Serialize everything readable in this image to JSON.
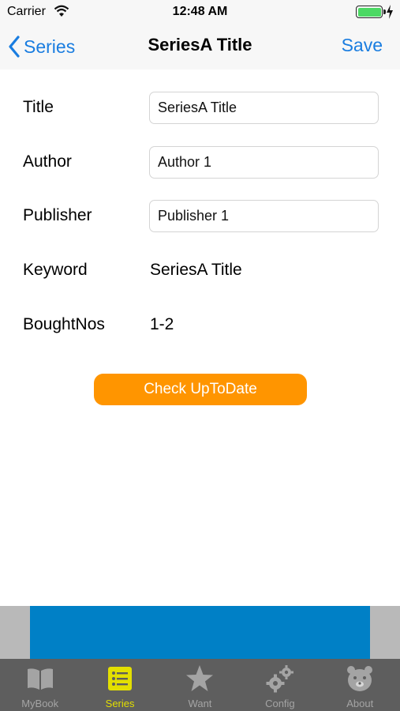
{
  "status_bar": {
    "carrier": "Carrier",
    "time": "12:48 AM",
    "battery_level": 1.0
  },
  "nav": {
    "back_label": "Series",
    "title": "SeriesA Title",
    "save_label": "Save"
  },
  "form": {
    "title": {
      "label": "Title",
      "value": "SeriesA Title"
    },
    "author": {
      "label": "Author",
      "value": "Author 1"
    },
    "publisher": {
      "label": "Publisher",
      "value": "Publisher 1"
    },
    "keyword": {
      "label": "Keyword",
      "value": "SeriesA Title"
    },
    "bought_nos": {
      "label": "BoughtNos",
      "value": "1-2"
    }
  },
  "check_button_label": "Check UpToDate",
  "colors": {
    "accent": "#1a7de0",
    "button": "#ff9500",
    "ad": "#0080c6",
    "tab_active": "#e3df00",
    "tab_inactive": "#a4a4a4",
    "tab_bar": "#5e5e5e"
  },
  "tabs": [
    {
      "label": "MyBook",
      "icon": "book-icon",
      "active": false
    },
    {
      "label": "Series",
      "icon": "list-icon",
      "active": true
    },
    {
      "label": "Want",
      "icon": "star-icon",
      "active": false
    },
    {
      "label": "Config",
      "icon": "gears-icon",
      "active": false
    },
    {
      "label": "About",
      "icon": "animal-face-icon",
      "active": false
    }
  ]
}
